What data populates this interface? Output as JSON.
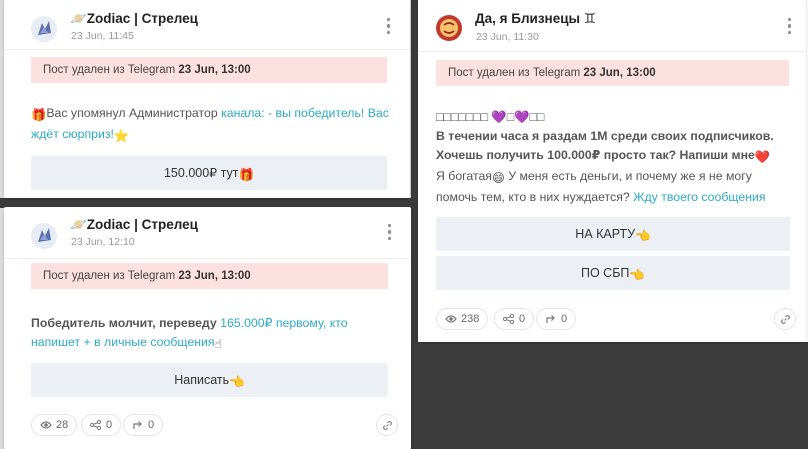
{
  "posts": [
    {
      "channel": "🪐Zodiac | Стрелец",
      "date": "23 Jun, 11:45",
      "deleted_prefix": "Пост удален из Telegram ",
      "deleted_date": "23 Jun, 13:00",
      "text": {
        "before": "Вас упомянул Администратор ",
        "link": "канала: - вы победитель! Вас ждёт сюрприз!"
      },
      "button": "150.000₽ тут"
    },
    {
      "channel": "🪐Zodiac | Стрелец",
      "date": "23 Jun, 12:10",
      "deleted_prefix": "Пост удален из Telegram ",
      "deleted_date": "23 Jun, 13:00",
      "text": {
        "bold": "Победитель молчит, переведу ",
        "link": "165.000₽ первому, кто напишет + в личные сообщения"
      },
      "button": "Написать",
      "stats": {
        "views": "28",
        "shares": "0",
        "reposts": "0"
      }
    },
    {
      "channel": "Да, я Близнецы ♊",
      "date": "23 Jun, 11:30",
      "deleted_prefix": "Пост удален из Telegram ",
      "deleted_date": "23 Jun, 13:00",
      "text": {
        "line1": "□□□□□□□ 💜□💜□□",
        "bold": "В течении часа я раздам 1М среди своих подписчиков. Хочешь получить 100.000₽ просто так? Напиши мне",
        "plain": "Я богатая",
        "plain2": " У меня есть деньги, и почему же я не могу помочь тем, кто в них нуждается? ",
        "link": "Жду твоего сообщения"
      },
      "buttons": [
        "НА КАРТУ",
        "ПО СБП"
      ],
      "stats": {
        "views": "238",
        "shares": "0",
        "reposts": "0"
      }
    }
  ],
  "colors": {
    "link": "#2eaac9",
    "deleted_bg": "#fde1e1",
    "button_bg": "#eceff3"
  }
}
